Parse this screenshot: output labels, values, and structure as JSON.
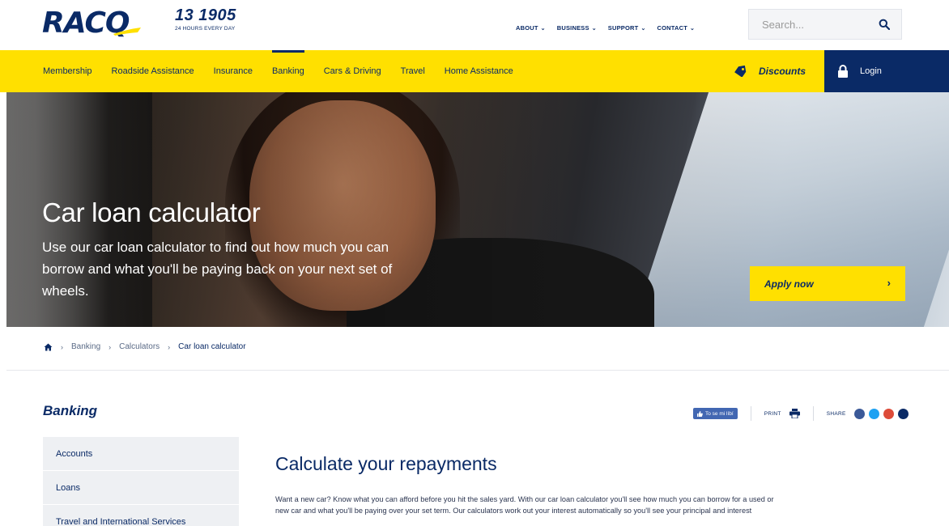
{
  "header": {
    "logo_text": "RACQ",
    "phone_number": "13 1905",
    "phone_sub": "24 HOURS EVERY DAY",
    "top_nav": [
      {
        "label": "ABOUT"
      },
      {
        "label": "BUSINESS"
      },
      {
        "label": "SUPPORT"
      },
      {
        "label": "CONTACT"
      }
    ],
    "search": {
      "placeholder": "Search...",
      "icon": "search-icon"
    }
  },
  "main_nav": {
    "items": [
      {
        "label": "Membership"
      },
      {
        "label": "Roadside Assistance"
      },
      {
        "label": "Insurance"
      },
      {
        "label": "Banking"
      },
      {
        "label": "Cars & Driving"
      },
      {
        "label": "Travel"
      },
      {
        "label": "Home Assistance"
      }
    ],
    "active": "Banking",
    "discounts_label": "Discounts",
    "login_label": "Login"
  },
  "hero": {
    "title": "Car loan calculator",
    "subtitle": "Use our car loan calculator to find out how much you can borrow and what you'll be paying back on your next set of wheels.",
    "apply_label": "Apply now"
  },
  "breadcrumb": {
    "items": [
      {
        "label": "Banking"
      },
      {
        "label": "Calculators"
      }
    ],
    "current": "Car loan calculator"
  },
  "section": {
    "title": "Banking",
    "fb_like_label": "To se mi líbí",
    "print_label": "PRINT",
    "share_label": "SHARE"
  },
  "sidebar": {
    "items": [
      {
        "label": "Accounts"
      },
      {
        "label": "Loans"
      },
      {
        "label": "Travel and International Services"
      }
    ]
  },
  "content": {
    "title": "Calculate your repayments",
    "line1": "Want a new car? Know what you can afford before you hit the sales yard. With our car loan calculator you'll see how much you can borrow for a used or",
    "line2": "new car and what you'll be paying over your set term. Our calculators work out your interest automatically so you'll see your principal and interest"
  },
  "colors": {
    "navy": "#0a2a66",
    "yellow": "#ffe000",
    "facebook": "#3b5998",
    "twitter": "#1da1f2",
    "google": "#dd4b39",
    "email": "#0a2a66"
  }
}
